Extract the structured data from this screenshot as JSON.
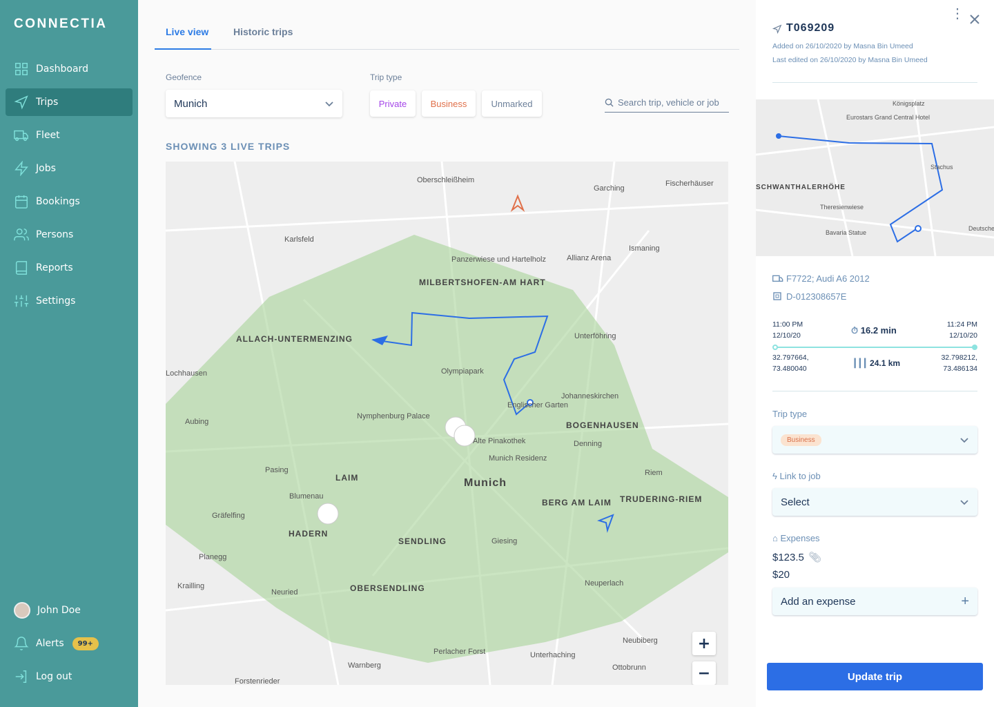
{
  "app": {
    "logo": "CONNECTIA"
  },
  "sidebar": {
    "items": [
      {
        "label": "Dashboard",
        "icon": "grid-icon"
      },
      {
        "label": "Trips",
        "icon": "navigation-icon",
        "active": true
      },
      {
        "label": "Fleet",
        "icon": "truck-icon"
      },
      {
        "label": "Jobs",
        "icon": "lightning-icon"
      },
      {
        "label": "Bookings",
        "icon": "calendar-icon"
      },
      {
        "label": "Persons",
        "icon": "users-icon"
      },
      {
        "label": "Reports",
        "icon": "book-icon"
      },
      {
        "label": "Settings",
        "icon": "sliders-icon"
      }
    ],
    "user": "John Doe",
    "alerts": "Alerts",
    "alerts_badge": "99+",
    "logout": "Log out"
  },
  "main": {
    "tabs": [
      {
        "label": "Live view",
        "active": true
      },
      {
        "label": "Historic trips"
      }
    ],
    "geofence_label": "Geofence",
    "geofence_value": "Munich",
    "trip_type_label": "Trip type",
    "trip_types": [
      {
        "label": "Private",
        "color": "#a445e8"
      },
      {
        "label": "Business",
        "color": "#e0704a"
      },
      {
        "label": "Unmarked",
        "color": "#6b7f99"
      }
    ],
    "search_placeholder": "Search trip, vehicle or job",
    "heading": "SHOWING 3 LIVE TRIPS",
    "map": {
      "places": [
        "Oberschleißheim",
        "Garching",
        "Fischerhäuser",
        "Karlsfeld",
        "Panzerwiese und Hartelholz",
        "Allianz Arena",
        "Ismaning",
        "MILBERTSHOFEN-AM HART",
        "ALLACH-UNTERMENZING",
        "Olympiapark",
        "Unterföhring",
        "Johanneskirchen",
        "Nymphenburg Palace",
        "Alte Pinakothek",
        "Englischer Garten",
        "BOGENHAUSEN",
        "Munich Residenz",
        "Denning",
        "Aubing",
        "Pasing",
        "LAIM",
        "Munich",
        "Riem",
        "BERG AM LAIM",
        "TRUDERING-RIEM",
        "Blumenau",
        "Gräfelfing",
        "HADERN",
        "SENDLING",
        "Giesing",
        "Planegg",
        "Neuperlach",
        "Krailling",
        "Neuried",
        "OBERSENDLING",
        "Perlacher Forst",
        "Neubiberg",
        "Unterhaching",
        "Ottobrunn",
        "Warnberg",
        "Forstenrieder",
        "Lochhausen"
      ],
      "zoom_in": "+",
      "zoom_out": "−",
      "geofence_color": "#a9d49a",
      "route_color": "#2c6ee5"
    }
  },
  "panel": {
    "trip_id": "T069209",
    "added": "Added on 26/10/2020 by Masna Bin Umeed",
    "edited": "Last edited on 26/10/2020 by Masna Bin Umeed",
    "minimap": {
      "places": [
        "Königsplatz",
        "Eurostars Grand Central Hotel",
        "Stachus",
        "SCHWANTHALERHÖHE",
        "Theresienwiese",
        "Bavaria Statue",
        "Deutsche"
      ]
    },
    "vehicle": "F7722; Audi A6 2012",
    "device": "D-012308657E",
    "start_time": "11:00 PM",
    "start_date": "12/10/20",
    "end_time": "11:24 PM",
    "end_date": "12/10/20",
    "duration": "16.2 min",
    "distance": "24.1 km",
    "start_coords_1": "32.797664,",
    "start_coords_2": "73.480040",
    "end_coords_1": "32.798212,",
    "end_coords_2": "73.486134",
    "trip_type_label": "Trip type",
    "trip_type_value": "Business",
    "link_job_label": "Link to job",
    "link_job_value": "Select",
    "expenses_label": "Expenses",
    "expenses": [
      "$123.5",
      "$20"
    ],
    "add_expense": "Add an expense",
    "update": "Update trip"
  }
}
